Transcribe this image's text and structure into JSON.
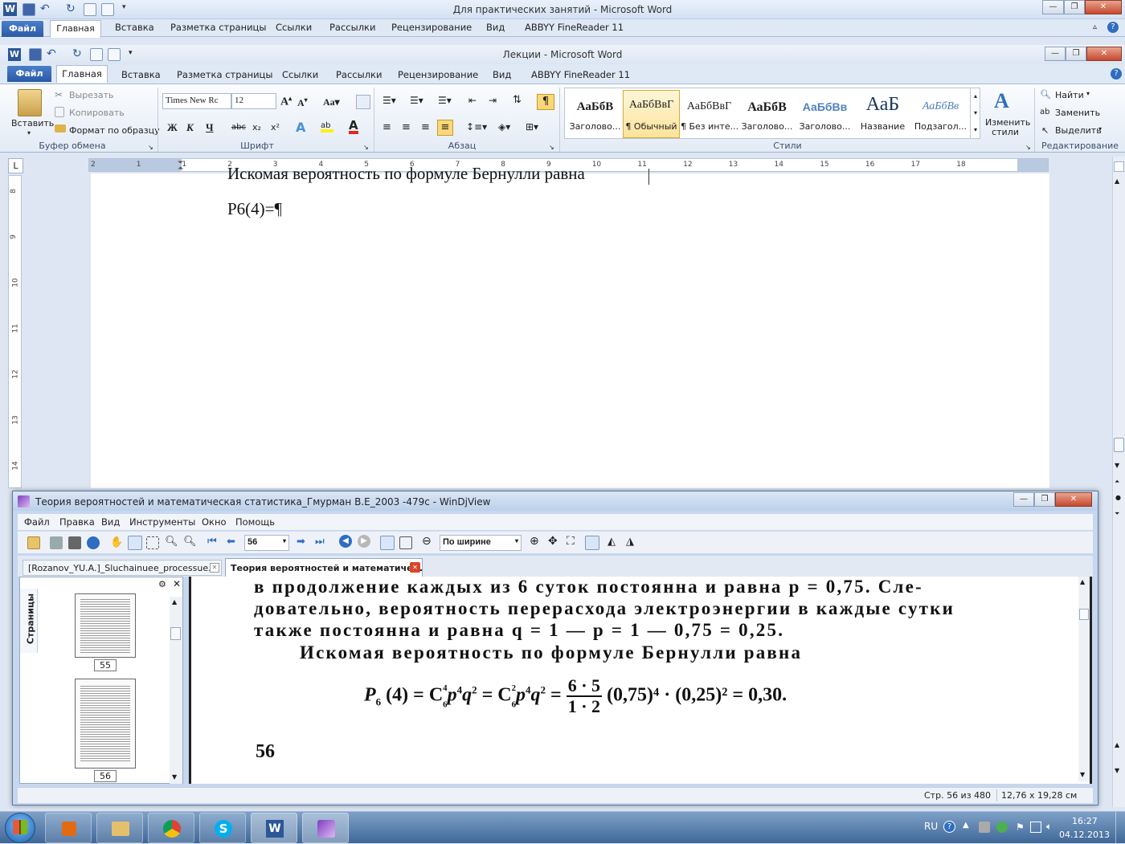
{
  "outer_word": {
    "title": "Для практических занятий  -  Microsoft Word",
    "file_tab": "Файл",
    "tabs": [
      "Главная",
      "Вставка",
      "Разметка страницы",
      "Ссылки",
      "Рассылки",
      "Рецензирование",
      "Вид",
      "ABBYY FineReader 11"
    ]
  },
  "inner_word": {
    "title": "Лекции  -  Microsoft Word",
    "file_tab": "Файл",
    "tabs": [
      "Главная",
      "Вставка",
      "Разметка страницы",
      "Ссылки",
      "Рассылки",
      "Рецензирование",
      "Вид",
      "ABBYY FineReader 11"
    ],
    "ribbon": {
      "clipboard": {
        "paste": "Вставить",
        "cut": "Вырезать",
        "copy": "Копировать",
        "format_painter": "Формат по образцу",
        "label": "Буфер обмена"
      },
      "font": {
        "name": "Times New Rc",
        "size": "12",
        "label": "Шрифт"
      },
      "paragraph": {
        "label": "Абзац"
      },
      "styles": {
        "items": [
          {
            "sample": "АаБбВ",
            "name": "Заголово..."
          },
          {
            "sample": "АаБбВвГ",
            "name": "¶ Обычный"
          },
          {
            "sample": "АаБбВвГ",
            "name": "¶ Без инте..."
          },
          {
            "sample": "АаБбВ",
            "name": "Заголово..."
          },
          {
            "sample": "АаБбВв",
            "name": "Заголово..."
          },
          {
            "sample": "АаБ",
            "name": "Название"
          },
          {
            "sample": "АаБбВв",
            "name": "Подзагол..."
          }
        ],
        "change_styles": "Изменить стили",
        "label": "Стили"
      },
      "editing": {
        "find": "Найти",
        "replace": "Заменить",
        "select": "Выделить",
        "label": "Редактирование"
      }
    },
    "ruler_numbers": [
      "2",
      "1",
      "1",
      "2",
      "3",
      "4",
      "5",
      "6",
      "7",
      "8",
      "9",
      "10",
      "11",
      "12",
      "13",
      "14",
      "15",
      "16",
      "17",
      "18"
    ],
    "vruler_numbers": [
      "8",
      "9",
      "10",
      "11",
      "12",
      "13",
      "14"
    ],
    "document": {
      "line1": "Искомая вероятность по формуле Бернулли равна",
      "line2": "P6(4)=¶"
    }
  },
  "windjview": {
    "title": "Теория вероятностей и математическая статистика_Гмурман В.Е_2003 -479с - WinDjView",
    "menu": [
      "Файл",
      "Правка",
      "Вид",
      "Инструменты",
      "Окно",
      "Помощь"
    ],
    "page_field": "56",
    "zoom_field": "По ширине",
    "tabs": [
      {
        "label": "[Rozanov_YU.A.]_Sluchainuee_processue...."
      },
      {
        "label": "Теория вероятностей и математиче..."
      }
    ],
    "sidebar_label": "Страницы",
    "thumbs": [
      "55",
      "56"
    ],
    "scan": {
      "line1": "в продолжение каждых из 6 суток постоянна и равна p = 0,75. Сле-",
      "line2": "довательно, вероятность перерасхода электроэнергии в каждые сутки",
      "line3": "также постоянна и равна q = 1 — p = 1 — 0,75 = 0,25.",
      "line4": "Искомая вероятность по формуле Бернулли равна",
      "formula_left": "P",
      "formula_sub": "6",
      "formula_main": "(4) = C",
      "c_sup": "4",
      "c_sub": "6",
      "p_part": "p",
      "p_sup": "4",
      "q_part": "q",
      "q_sup": "2",
      "eq2": " = C",
      "c2_sup": "2",
      "c2_sub": "6",
      "eq3": " = ",
      "numerator": "6 · 5",
      "denominator": "1 · 2",
      "tail": "(0,75)⁴ · (0,25)² = 0,30.",
      "page_number": "56"
    },
    "status": {
      "page": "Стр. 56 из 480",
      "size": "12,76 x 19,28 см"
    }
  },
  "taskbar": {
    "lang": "RU",
    "time": "16:27",
    "date": "04.12.2013"
  },
  "colors": {
    "accent": "#2b5797",
    "ribbon_bg": "#e3ebf6",
    "selected_style": "#fbd778",
    "close_red": "#c7482d"
  }
}
